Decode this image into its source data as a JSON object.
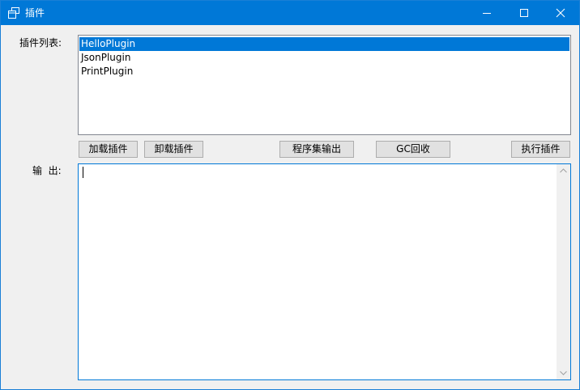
{
  "window": {
    "title": "插件"
  },
  "labels": {
    "plugin_list": "插件列表:",
    "output": "输  出:"
  },
  "plugin_list": {
    "items": [
      "HelloPlugin",
      "JsonPlugin",
      "PrintPlugin"
    ],
    "selected_index": 0
  },
  "buttons": {
    "load": "加载插件",
    "unload": "卸载插件",
    "assembly_output": "程序集输出",
    "gc": "GC回收",
    "execute": "执行插件"
  },
  "output": {
    "text": ""
  },
  "colors": {
    "titlebar": "#0078d7",
    "selection": "#0078d7",
    "window_bg": "#f0f0f0"
  },
  "icons": {
    "app": "app-window-icon",
    "minimize": "minimize-icon",
    "maximize": "maximize-icon",
    "close": "close-icon"
  }
}
